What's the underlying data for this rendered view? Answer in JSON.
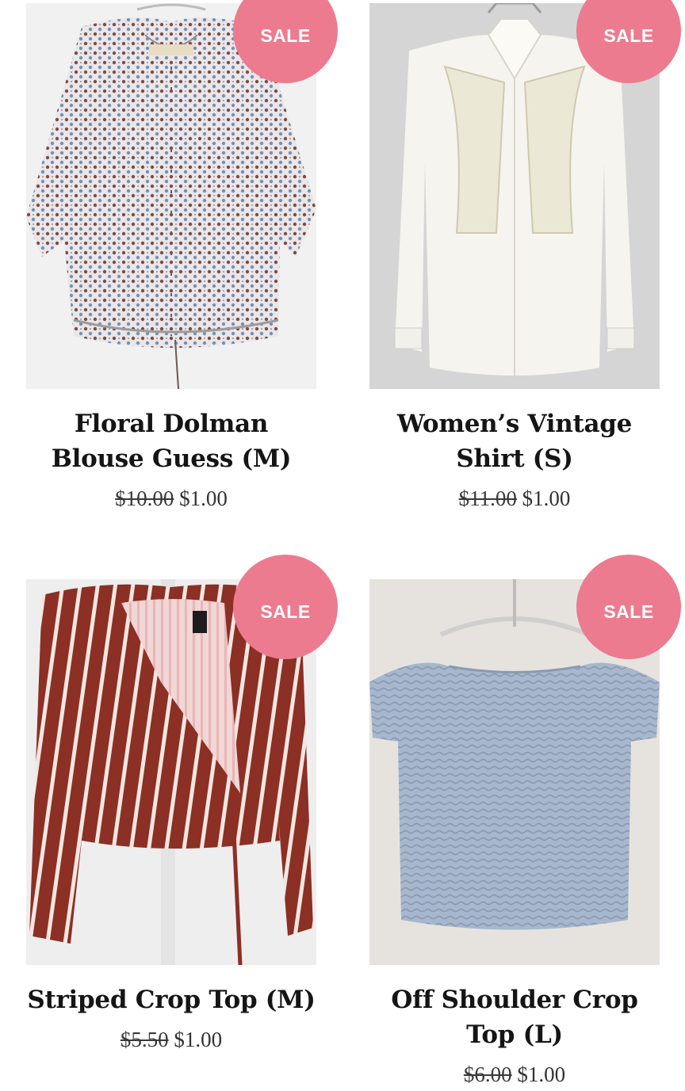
{
  "colors": {
    "sale_badge": "#ec7b8f",
    "title_text": "#151515",
    "price_text": "#333333"
  },
  "products": [
    {
      "badge": "SALE",
      "title": "Floral Dolman Blouse Guess (M)",
      "original_price": "$10.00",
      "sale_price": "$1.00",
      "image_icon": "patterned-blouse-image"
    },
    {
      "badge": "SALE",
      "title": "Women’s Vintage Shirt (S)",
      "original_price": "$11.00",
      "sale_price": "$1.00",
      "image_icon": "white-shirt-image"
    },
    {
      "badge": "SALE",
      "title": "Striped Crop Top (M)",
      "original_price": "$5.50",
      "sale_price": "$1.00",
      "image_icon": "striped-wrap-top-image"
    },
    {
      "badge": "SALE",
      "title": "Off Shoulder Crop Top (L)",
      "original_price": "$6.00",
      "sale_price": "$1.00",
      "image_icon": "smocked-crop-top-image"
    }
  ]
}
